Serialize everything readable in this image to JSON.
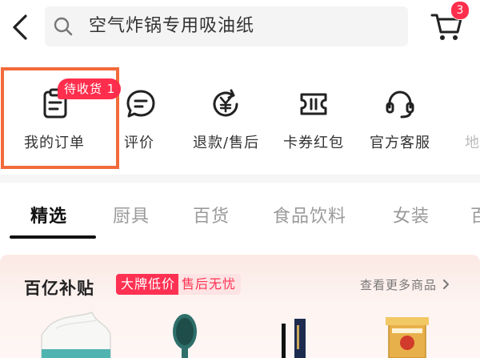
{
  "search": {
    "query": "空气炸锅专用吸油纸"
  },
  "cart": {
    "badge_count": "3"
  },
  "shortcuts": [
    {
      "label": "我的订单",
      "badge": "待收货 1"
    },
    {
      "label": "评价"
    },
    {
      "label": "退款/售后"
    },
    {
      "label": "卡券红包"
    },
    {
      "label": "官方客服"
    },
    {
      "label": "地"
    }
  ],
  "tabs": [
    "精选",
    "厨具",
    "百货",
    "食品饮料",
    "女装",
    "百"
  ],
  "active_tab": "精选",
  "subsidy": {
    "title": "百亿补贴",
    "tag_primary": "大牌低价",
    "tag_secondary": "售后无忧",
    "more_link": "查看更多商品",
    "products": [
      "tissue-box-product",
      "hair-brush-product",
      "lipstick-product",
      "snack-box-product"
    ]
  },
  "colors": {
    "accent": "#ff2e4c",
    "highlight_border": "#f26b3a",
    "panel_bg": "#fbe9e4"
  },
  "icons": [
    "back-arrow-icon",
    "search-icon",
    "cart-icon",
    "order-list-icon",
    "comment-icon",
    "refund-icon",
    "coupon-icon",
    "headset-icon"
  ]
}
